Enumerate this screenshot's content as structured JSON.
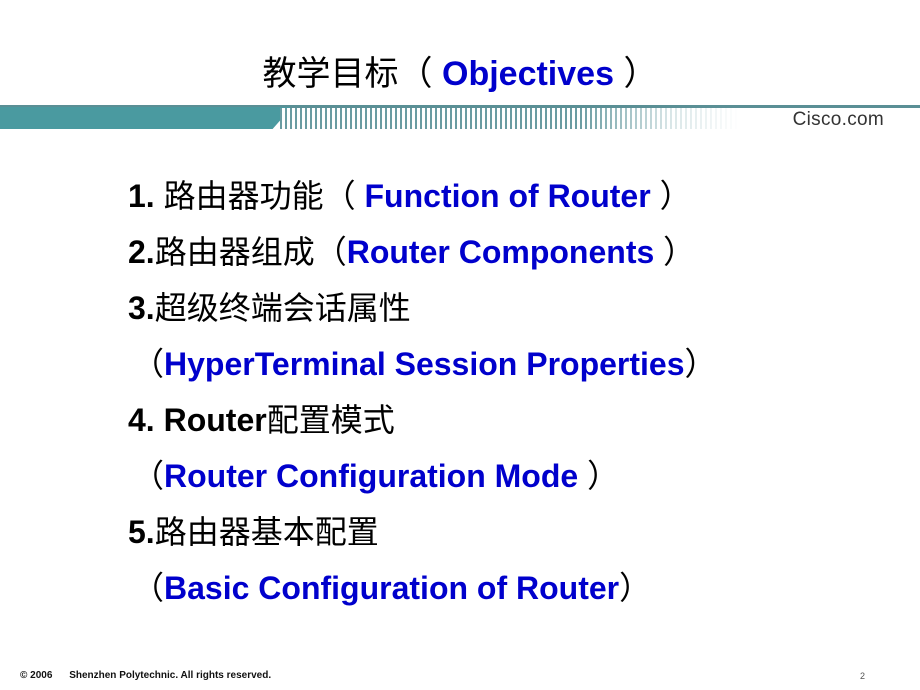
{
  "slide": {
    "title": {
      "cn": "教学目标（",
      "en": "Objectives",
      "close": "）"
    },
    "banner": {
      "brand": "Cisco.com",
      "colors": {
        "teal": "#4a9aa0",
        "line": "#5a8f95"
      }
    },
    "items": [
      {
        "num": "1.",
        "cn": "路由器功能",
        "open": "（",
        "en": "Function of Router",
        "close": "）"
      },
      {
        "num": "2.",
        "cn": "路由器组成",
        "open": "（",
        "en": "Router Components",
        "close": "）"
      },
      {
        "num": "3.",
        "cn": "超级终端会话属性"
      },
      {
        "open": "（",
        "en": "HyperTerminal Session Properties",
        "close": "）"
      },
      {
        "num": "4. Router",
        "cn": "配置模式"
      },
      {
        "open": "（",
        "en": "Router Configuration Mode",
        "close": "）"
      },
      {
        "num": "5.",
        "cn": "路由器基本配置"
      },
      {
        "open": "（",
        "en": "Basic Configuration of Router",
        "close": "）"
      }
    ],
    "footer": {
      "copyright": "© 2006",
      "text": "Shenzhen Polytechnic. All rights reserved.",
      "page_number": "2"
    },
    "colors": {
      "accent_text": "#0000cc",
      "body_text": "#000000"
    }
  }
}
